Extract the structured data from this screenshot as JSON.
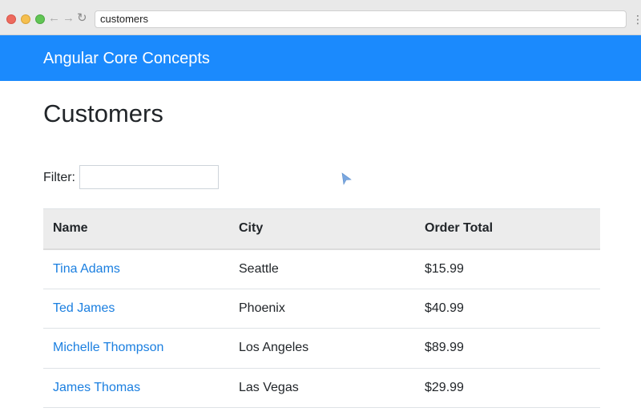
{
  "browser": {
    "url": "customers",
    "back_glyph": "←",
    "forward_glyph": "→",
    "reload_glyph": "↻",
    "menu_glyph": "⋮"
  },
  "navbar": {
    "brand": "Angular Core Concepts",
    "color": "#1b8afd"
  },
  "page": {
    "title": "Customers"
  },
  "filter": {
    "label": "Filter:",
    "value": "",
    "placeholder": ""
  },
  "table": {
    "headers": [
      "Name",
      "City",
      "Order Total"
    ],
    "rows": [
      {
        "name": "Tina Adams",
        "city": "Seattle",
        "order_total": "$15.99"
      },
      {
        "name": "Ted James",
        "city": "Phoenix",
        "order_total": "$40.99"
      },
      {
        "name": "Michelle Thompson",
        "city": "Los Angeles",
        "order_total": "$89.99"
      },
      {
        "name": "James Thomas",
        "city": "Las Vegas",
        "order_total": "$29.99"
      }
    ]
  },
  "colors": {
    "link": "#1b7fe0",
    "header_bg": "#ececec"
  }
}
